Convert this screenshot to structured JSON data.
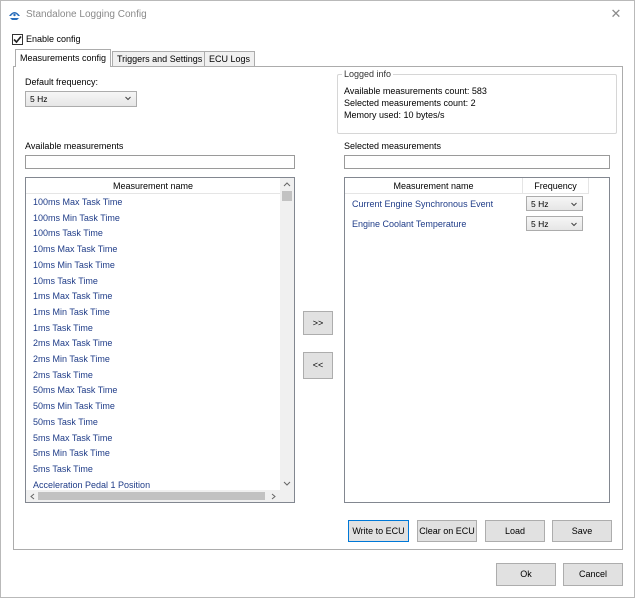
{
  "window": {
    "title": "Standalone Logging Config",
    "close_glyph": "✕"
  },
  "enable_config": {
    "label": "Enable config",
    "checked": true
  },
  "tabs": [
    {
      "label": "Measurements config",
      "active": true
    },
    {
      "label": "Triggers and Settings",
      "active": false
    },
    {
      "label": "ECU Logs",
      "active": false
    }
  ],
  "default_frequency": {
    "label": "Default frequency:",
    "value": "5 Hz"
  },
  "logged_info": {
    "title": "Logged info",
    "available_count": "Available measurements count: 583",
    "selected_count": "Selected measurements count: 2",
    "memory_used": "Memory used: 10 bytes/s"
  },
  "available": {
    "label": "Available measurements",
    "filter_value": "",
    "column_header": "Measurement name",
    "items": [
      "100ms Max Task Time",
      "100ms Min Task Time",
      "100ms Task Time",
      "10ms Max Task Time",
      "10ms Min Task Time",
      "10ms Task Time",
      "1ms Max Task Time",
      "1ms Min Task Time",
      "1ms Task Time",
      "2ms Max Task Time",
      "2ms Min Task Time",
      "2ms Task Time",
      "50ms Max Task Time",
      "50ms Min Task Time",
      "50ms Task Time",
      "5ms Max Task Time",
      "5ms Min Task Time",
      "5ms Task Time",
      "Acceleration Pedal 1 Position"
    ]
  },
  "transfer": {
    "add_label": ">>",
    "remove_label": "<<"
  },
  "selected": {
    "label": "Selected measurements",
    "filter_value": "",
    "column_name_header": "Measurement name",
    "column_freq_header": "Frequency",
    "items": [
      {
        "name": "Current Engine Synchronous Event",
        "frequency": "5 Hz"
      },
      {
        "name": "Engine Coolant Temperature",
        "frequency": "5 Hz"
      }
    ]
  },
  "panel_buttons": {
    "write_to_ecu": "Write to ECU",
    "clear_on_ecu": "Clear on ECU",
    "load": "Load",
    "save": "Save"
  },
  "dialog_buttons": {
    "ok": "Ok",
    "cancel": "Cancel"
  },
  "colors": {
    "accent": "#0078d7",
    "item_text": "#1f3c88",
    "button_face": "#e1e1e1"
  }
}
